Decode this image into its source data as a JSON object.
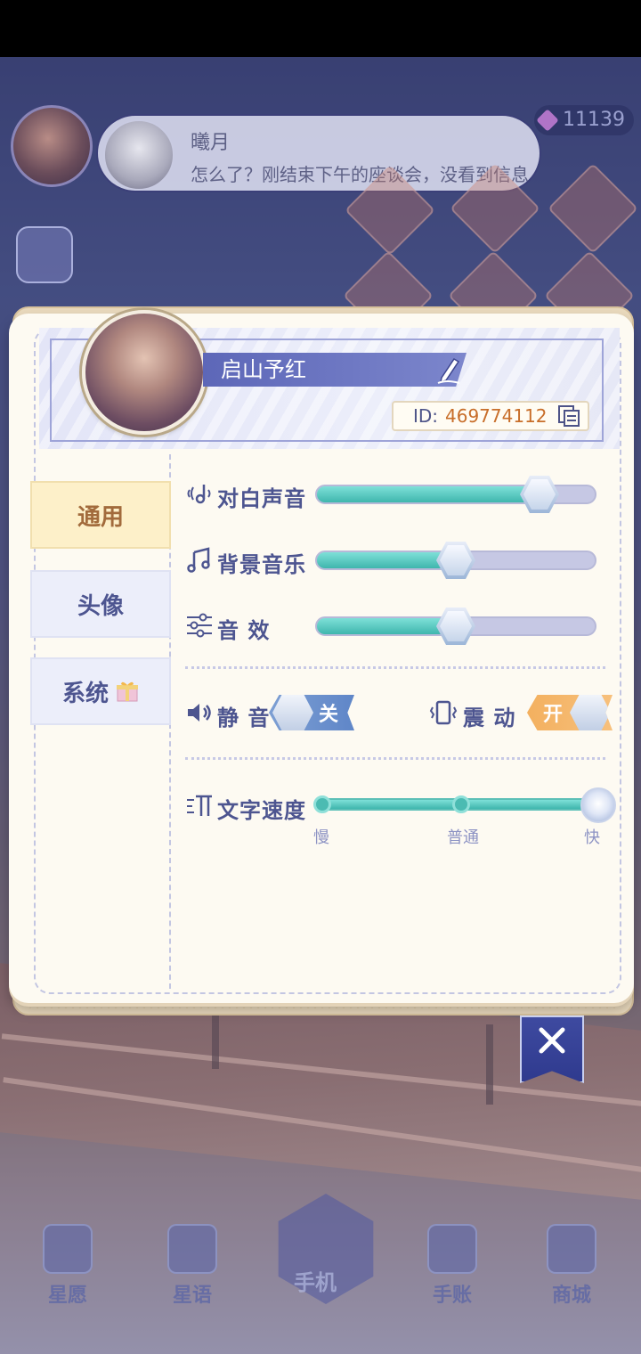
{
  "background": {
    "currency_value": "11139",
    "message": {
      "sender": "曦月",
      "text": "怎么了？刚结束下午的座谈会，没看到信息"
    },
    "bottom_nav": [
      "星愿",
      "星语",
      "手机",
      "手账",
      "商城"
    ]
  },
  "profile": {
    "name": "启山予红",
    "id_label": "ID:",
    "id_value": "469774112"
  },
  "tabs": [
    {
      "label": "通用",
      "active": true
    },
    {
      "label": "头像",
      "active": false
    },
    {
      "label": "系统",
      "active": false
    }
  ],
  "audio": {
    "dialogue_label": "对白声音",
    "dialogue_level": 0.8,
    "bgm_label": "背景音乐",
    "bgm_level": 0.5,
    "sfx_label": "音 效",
    "sfx_level": 0.5
  },
  "toggles": {
    "mute_label": "静 音",
    "mute_state": "关",
    "vibrate_label": "震 动",
    "vibrate_state": "开"
  },
  "text_speed": {
    "label": "文字速度",
    "options": [
      "慢",
      "普通",
      "快"
    ],
    "selected": "快"
  },
  "colors": {
    "accent_teal": "#3fb6ad",
    "tab_active_bg": "#fdf0c9",
    "text_primary": "#4d5590",
    "id_value": "#c86e2a",
    "toggle_on": "#f3b05f",
    "toggle_off": "#5f86c8"
  }
}
